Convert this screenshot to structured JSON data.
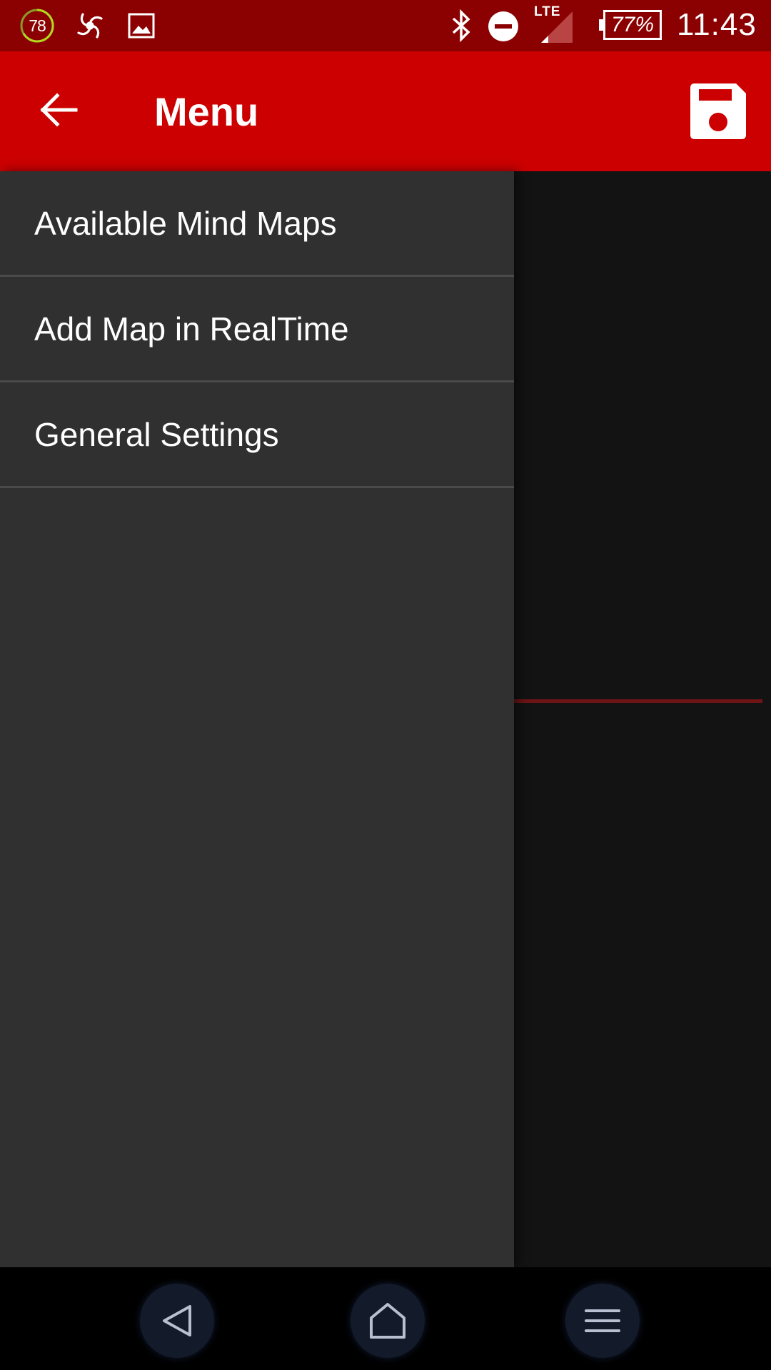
{
  "status_bar": {
    "score_badge": "78",
    "network": "LTE",
    "battery": "77%",
    "time": "11:43",
    "icons": [
      "score-ring-icon",
      "swirl-icon",
      "image-icon",
      "bluetooth-icon",
      "do-not-disturb-icon",
      "signal-icon",
      "battery-icon"
    ]
  },
  "toolbar": {
    "title": "Menu",
    "back_icon": "arrow-left-icon",
    "save_icon": "floppy-disk-icon"
  },
  "drawer": {
    "items": [
      {
        "label": "Available Mind Maps"
      },
      {
        "label": "Add Map in RealTime"
      },
      {
        "label": "General Settings"
      }
    ]
  },
  "nav_bar": {
    "buttons": [
      "back-triangle-icon",
      "home-icon",
      "menu-lines-icon"
    ]
  },
  "colors": {
    "status_bar": "#8b0000",
    "toolbar": "#cc0000",
    "drawer_bg": "#303030",
    "content_bg": "#131313",
    "nav_bg": "#000000"
  }
}
